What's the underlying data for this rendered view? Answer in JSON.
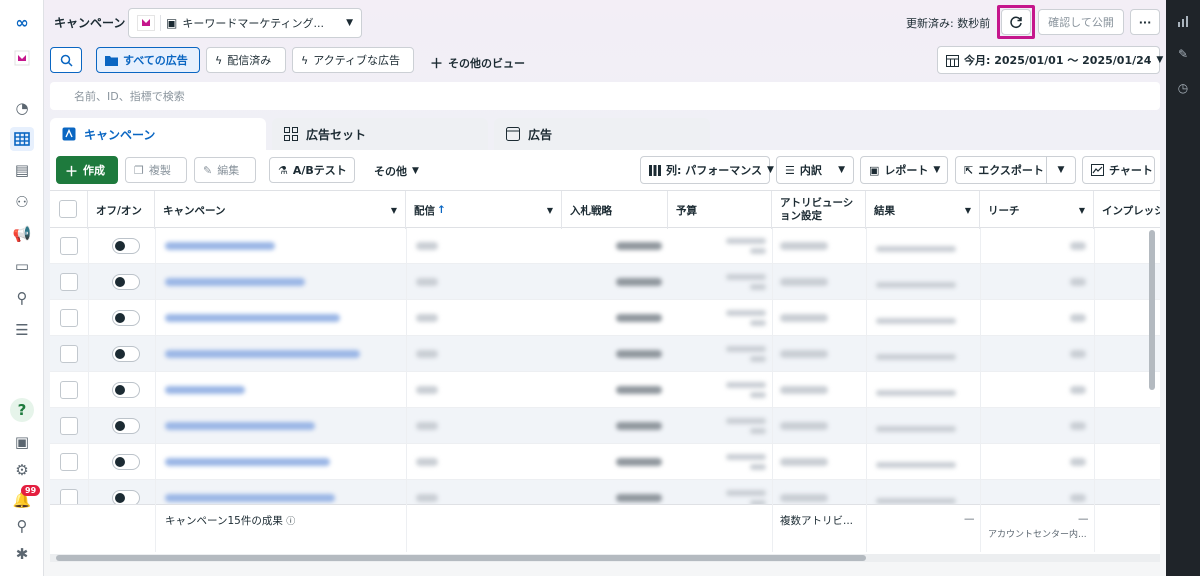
{
  "header": {
    "page_title": "キャンペーン",
    "account_name": "キーワードマーケティング...",
    "updated_status": "更新済み: 数秒前",
    "publish_label": "確認して公開",
    "more_label": "···"
  },
  "views": {
    "all_ads": "すべての広告",
    "delivered": "配信済み",
    "active_ads": "アクティブな広告",
    "other_views": "その他のビュー",
    "date_range": "今月: 2025/01/01 ～ 2025/01/24"
  },
  "search": {
    "placeholder": "名前、ID、指標で検索"
  },
  "tabs": [
    {
      "label": "キャンペーン"
    },
    {
      "label": "広告セット"
    },
    {
      "label": "広告"
    }
  ],
  "toolbar": {
    "create": "作成",
    "duplicate": "複製",
    "edit": "編集",
    "ab_test": "A/Bテスト",
    "other": "その他",
    "columns": "列: パフォーマンス",
    "breakdown": "内訳",
    "reports": "レポート",
    "export": "エクスポート",
    "chart": "チャート"
  },
  "table": {
    "columns": [
      "オフ/オン",
      "キャンペーン",
      "配信",
      "入札戦略",
      "予算",
      "アトリビューション設定",
      "結果",
      "リーチ",
      "インプレッション"
    ],
    "sort_indicator": "↑",
    "row_count": 8
  },
  "footer": {
    "summary": "キャンペーン15件の成果",
    "attribution": "複数アトリビ...",
    "results_dash": "—",
    "reach_dash": "—",
    "reach_sub": "アカウントセンター内..."
  },
  "notifications": {
    "count": "99"
  },
  "colors": {
    "accent": "#0a66c2",
    "create_green": "#1e7a3d",
    "highlight": "#c5168c",
    "badge": "#e41e3f"
  }
}
